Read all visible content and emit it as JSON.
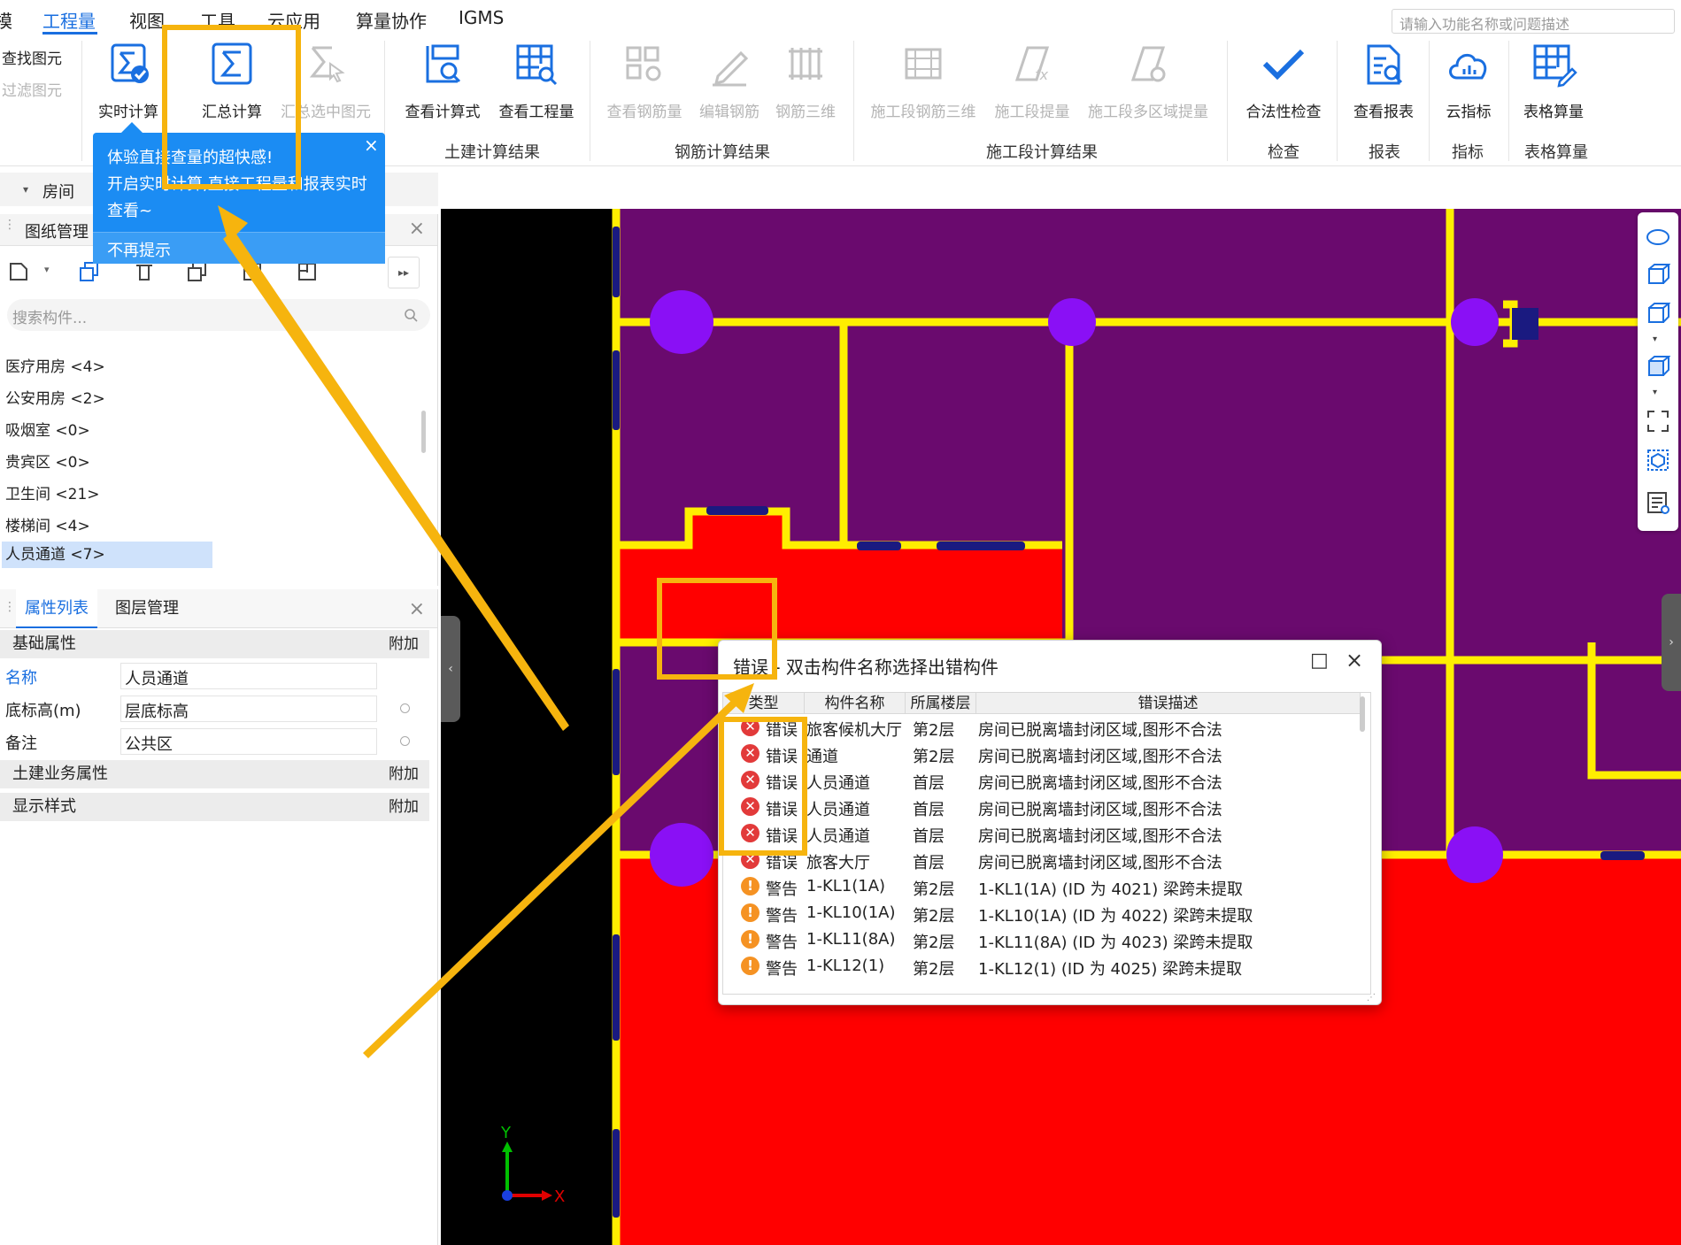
{
  "menu": {
    "items": [
      "模",
      "工程量",
      "视图",
      "工具",
      "云应用",
      "算量协作",
      "IGMS"
    ],
    "active": "工程量",
    "search_placeholder": "请输入功能名称或问题描述"
  },
  "ribbon": {
    "small_buttons": [
      "查找图元",
      "过滤图元"
    ],
    "realtime": "实时计算",
    "summary": "汇总计算",
    "summary_selected": "汇总选中图元",
    "civil": {
      "view_formula": "查看计算式",
      "view_quantity": "查看工程量",
      "group": "土建计算结果"
    },
    "rebar": {
      "view_rebar": "查看钢筋量",
      "edit_rebar": "编辑钢筋",
      "rebar_3d": "钢筋三维",
      "group": "钢筋计算结果"
    },
    "stage": {
      "stage_rebar_3d": "施工段钢筋三维",
      "stage_extract": "施工段提量",
      "stage_multi": "施工段多区域提量",
      "group": "施工段计算结果"
    },
    "check": {
      "legality": "合法性检查",
      "group": "检查"
    },
    "report": {
      "view_report": "查看报表",
      "group": "报表"
    },
    "index": {
      "cloud_index": "云指标",
      "group": "指标"
    },
    "table": {
      "table_calc": "表格算量",
      "group": "表格算量"
    }
  },
  "tooltip": {
    "line1": "体验直接查量的超快感!",
    "line2": "开启实时计算,直接工程量和报表实时",
    "line3": "查看~",
    "dismiss": "不再提示",
    "close": "×"
  },
  "room_tab": {
    "label": "房间"
  },
  "drawing_panel": {
    "title": "图纸管理",
    "close": "×",
    "search_placeholder": "搜索构件...",
    "items": [
      "医疗用房 <4>",
      "公安用房 <2>",
      "吸烟室 <0>",
      "贵宾区 <0>",
      "卫生间 <21>",
      "楼梯间 <4>",
      "人员通道 <7>"
    ],
    "selected": "人员通道 <7>"
  },
  "prop_panel": {
    "tabs": [
      "属性列表",
      "图层管理"
    ],
    "close": "×",
    "groups": {
      "basic": "基础属性",
      "civil": "土建业务属性",
      "display": "显示样式",
      "add": "附加"
    },
    "rows": [
      {
        "key": "名称",
        "value": "人员通道"
      },
      {
        "key": "底标高(m)",
        "value": "层底标高"
      },
      {
        "key": "备注",
        "value": "公共区"
      }
    ]
  },
  "dialog": {
    "title": "错误 - 双击构件名称选择出错构件",
    "max": "□",
    "close": "×",
    "headers": [
      "类型",
      "构件名称",
      "所属楼层",
      "错误描述"
    ],
    "rows": [
      {
        "type": "错误",
        "name": "旅客候机大厅",
        "floor": "第2层",
        "desc": "房间已脱离墙封闭区域,图形不合法",
        "level": "error"
      },
      {
        "type": "错误",
        "name": "通道",
        "floor": "第2层",
        "desc": "房间已脱离墙封闭区域,图形不合法",
        "level": "error"
      },
      {
        "type": "错误",
        "name": "人员通道",
        "floor": "首层",
        "desc": "房间已脱离墙封闭区域,图形不合法",
        "level": "error"
      },
      {
        "type": "错误",
        "name": "人员通道",
        "floor": "首层",
        "desc": "房间已脱离墙封闭区域,图形不合法",
        "level": "error"
      },
      {
        "type": "错误",
        "name": "人员通道",
        "floor": "首层",
        "desc": "房间已脱离墙封闭区域,图形不合法",
        "level": "error"
      },
      {
        "type": "错误",
        "name": "旅客大厅",
        "floor": "首层",
        "desc": "房间已脱离墙封闭区域,图形不合法",
        "level": "error"
      },
      {
        "type": "警告",
        "name": "1-KL1(1A)",
        "floor": "第2层",
        "desc": "1-KL1(1A) (ID 为 4021) 梁跨未提取",
        "level": "warning"
      },
      {
        "type": "警告",
        "name": "1-KL10(1A)",
        "floor": "第2层",
        "desc": "1-KL10(1A) (ID 为 4022) 梁跨未提取",
        "level": "warning"
      },
      {
        "type": "警告",
        "name": "1-KL11(8A)",
        "floor": "第2层",
        "desc": "1-KL11(8A) (ID 为 4023) 梁跨未提取",
        "level": "warning"
      },
      {
        "type": "警告",
        "name": "1-KL12(1)",
        "floor": "第2层",
        "desc": "1-KL12(1) (ID 为 4025) 梁跨未提取",
        "level": "warning"
      }
    ]
  },
  "axis": {
    "x": "X",
    "y": "Y"
  },
  "colors": {
    "accent": "#1a6fe0",
    "tooltip_bg": "#1b8cf3",
    "room_purple": "#6a0a6e",
    "room_red": "#ff0000",
    "wall_yellow": "#ffee00",
    "column_violet": "#8a10f5",
    "highlight": "#f6b40e",
    "error": "#e23a3a",
    "warning": "#f59223"
  }
}
